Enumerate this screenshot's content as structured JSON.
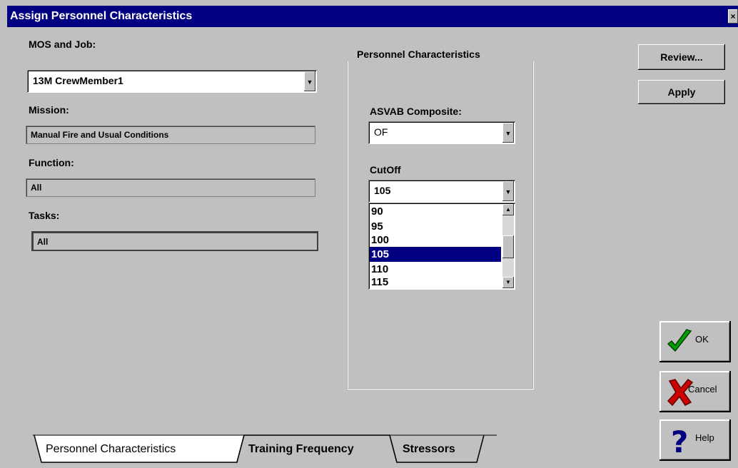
{
  "window": {
    "title": "Assign Personnel Characteristics",
    "close_glyph": "×"
  },
  "left": {
    "mos_label": "MOS and Job:",
    "mos_value": "13M CrewMember1",
    "mission_label": "Mission:",
    "mission_value": "Manual Fire and Usual Conditions",
    "function_label": "Function:",
    "function_value": "All",
    "tasks_label": "Tasks:",
    "tasks_value": "All"
  },
  "personnel": {
    "group_label": "Personnel Characteristics",
    "asvab_label": "ASVAB Composite:",
    "asvab_value": "OF",
    "cutoff_label": "CutOff",
    "cutoff_value": "105",
    "cutoff_options": [
      "90",
      "95",
      "100",
      "105",
      "110",
      "115"
    ],
    "selected_index": 3
  },
  "buttons": {
    "review": "Review...",
    "apply": "Apply",
    "ok": "OK",
    "cancel": "Cancel",
    "help": "Help"
  },
  "tabs": [
    "Personnel Characteristics",
    "Training Frequency",
    "Stressors"
  ],
  "colors": {
    "titlebar": "#000080",
    "ok_check": "#00a000",
    "cancel_x": "#cc0000",
    "help_q": "#000080"
  }
}
